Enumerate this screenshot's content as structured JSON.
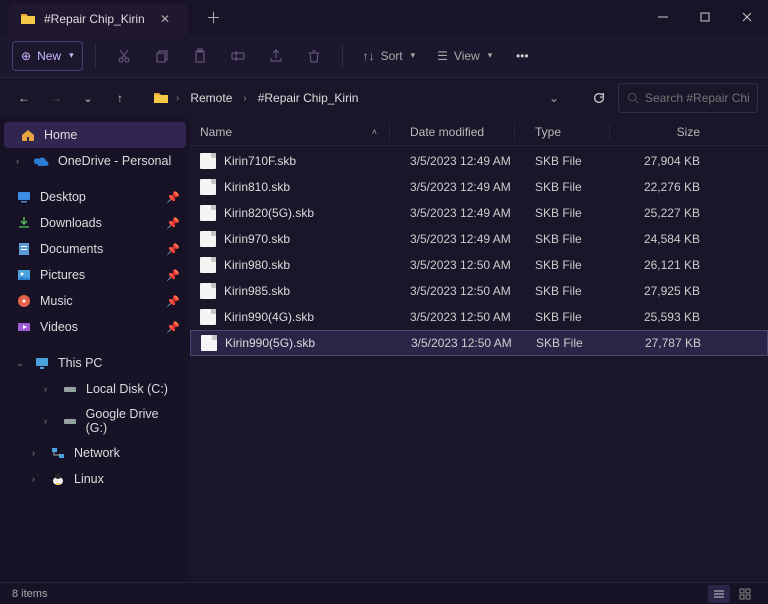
{
  "window": {
    "tab_title": "#Repair Chip_Kirin"
  },
  "toolbar": {
    "new_label": "New",
    "sort_label": "Sort",
    "view_label": "View"
  },
  "breadcrumbs": [
    "Remote",
    "#Repair Chip_Kirin"
  ],
  "search": {
    "placeholder": "Search #Repair Chi..."
  },
  "nav": {
    "home": "Home",
    "onedrive": "OneDrive - Personal",
    "quick": [
      {
        "label": "Desktop"
      },
      {
        "label": "Downloads"
      },
      {
        "label": "Documents"
      },
      {
        "label": "Pictures"
      },
      {
        "label": "Music"
      },
      {
        "label": "Videos"
      }
    ],
    "this_pc": "This PC",
    "drives": [
      {
        "label": "Local Disk (C:)"
      },
      {
        "label": "Google Drive (G:)"
      }
    ],
    "network": "Network",
    "linux": "Linux"
  },
  "columns": {
    "name": "Name",
    "date": "Date modified",
    "type": "Type",
    "size": "Size"
  },
  "files": [
    {
      "name": "Kirin710F.skb",
      "date": "3/5/2023 12:49 AM",
      "type": "SKB File",
      "size": "27,904 KB"
    },
    {
      "name": "Kirin810.skb",
      "date": "3/5/2023 12:49 AM",
      "type": "SKB File",
      "size": "22,276 KB"
    },
    {
      "name": "Kirin820(5G).skb",
      "date": "3/5/2023 12:49 AM",
      "type": "SKB File",
      "size": "25,227 KB"
    },
    {
      "name": "Kirin970.skb",
      "date": "3/5/2023 12:49 AM",
      "type": "SKB File",
      "size": "24,584 KB"
    },
    {
      "name": "Kirin980.skb",
      "date": "3/5/2023 12:50 AM",
      "type": "SKB File",
      "size": "26,121 KB"
    },
    {
      "name": "Kirin985.skb",
      "date": "3/5/2023 12:50 AM",
      "type": "SKB File",
      "size": "27,925 KB"
    },
    {
      "name": "Kirin990(4G).skb",
      "date": "3/5/2023 12:50 AM",
      "type": "SKB File",
      "size": "25,593 KB"
    },
    {
      "name": "Kirin990(5G).skb",
      "date": "3/5/2023 12:50 AM",
      "type": "SKB File",
      "size": "27,787 KB"
    }
  ],
  "selected_index": 7,
  "status": {
    "count_label": "8 items"
  }
}
